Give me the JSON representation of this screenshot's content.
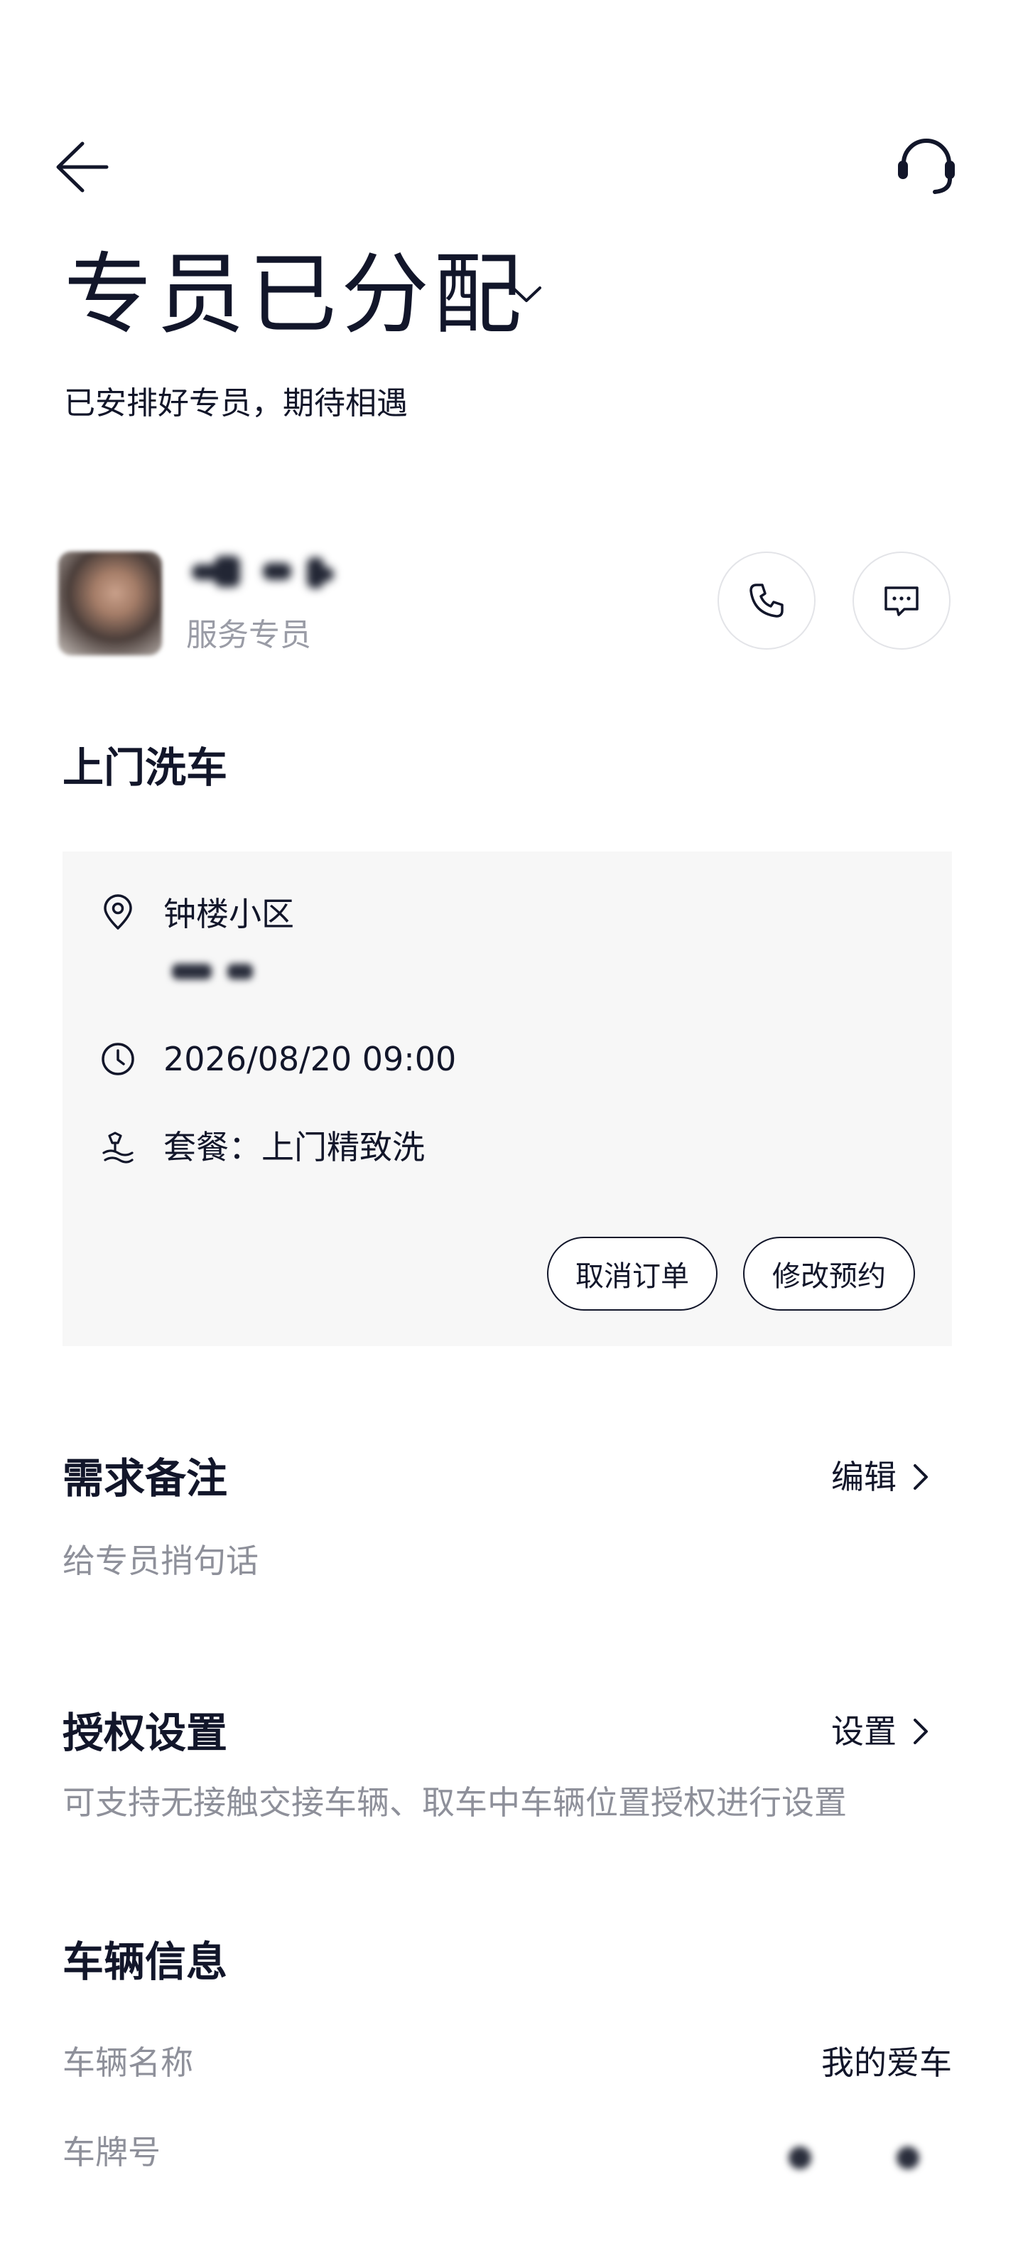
{
  "header": {
    "back_icon": "arrow-left-icon",
    "support_icon": "headset-icon"
  },
  "status": {
    "title": "专员已分配",
    "subtitle": "已安排好专员，期待相遇",
    "chevron_icon": "chevron-down-icon"
  },
  "specialist": {
    "role": "服务专员",
    "call_icon": "phone-icon",
    "message_icon": "message-icon"
  },
  "service": {
    "title": "上门洗车",
    "address": "钟楼小区",
    "datetime": "2026/08/20 09:00",
    "package": "套餐：上门精致洗",
    "cancel_label": "取消订单",
    "modify_label": "修改预约"
  },
  "remarks": {
    "title": "需求备注",
    "action_label": "编辑",
    "placeholder": "给专员捎句话"
  },
  "authorization": {
    "title": "授权设置",
    "action_label": "设置",
    "description": "可支持无接触交接车辆、取车中车辆位置授权进行设置"
  },
  "vehicle": {
    "title": "车辆信息",
    "name_label": "车辆名称",
    "name_value": "我的爱车",
    "plate_label": "车牌号"
  },
  "colors": {
    "text_primary": "#12162a",
    "text_secondary": "#8e909a",
    "card_bg": "#f7f7f7"
  }
}
